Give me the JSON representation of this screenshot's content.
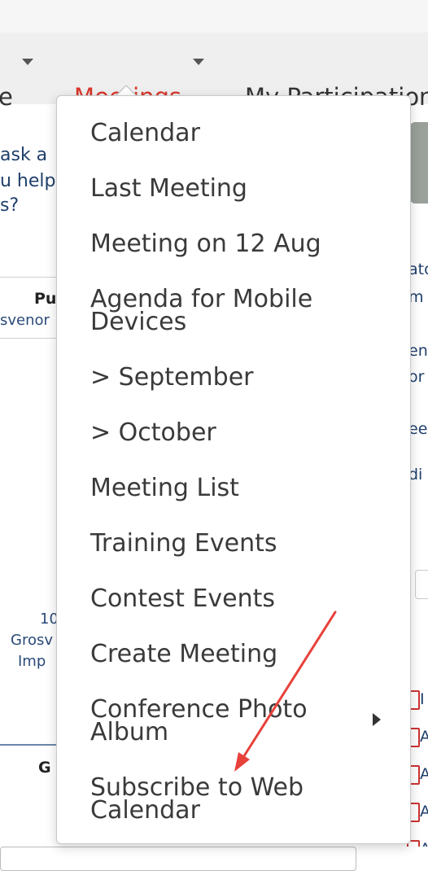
{
  "navbar": {
    "items": [
      {
        "label": "e"
      },
      {
        "label": "Meetings"
      },
      {
        "label": "My Participation"
      }
    ]
  },
  "background": {
    "left_text": [
      "ask a",
      "u help",
      "s?"
    ],
    "col_header": "Pu",
    "col_sub": "svenor",
    "address": [
      "10",
      "Grosv",
      "Imp"
    ],
    "lower_header": "G"
  },
  "right_strip": {
    "texts": [
      "ato",
      "m",
      "en",
      "or",
      "ee",
      "di"
    ],
    "badge_letters": [
      "I",
      "A",
      "A",
      "A",
      "A"
    ]
  },
  "dropdown": {
    "items": [
      {
        "label": "Calendar"
      },
      {
        "label": "Last Meeting"
      },
      {
        "label": "Meeting on 12 Aug"
      },
      {
        "label": "Agenda for Mobile Devices"
      },
      {
        "label": "> September"
      },
      {
        "label": "> October"
      },
      {
        "label": "Meeting List"
      },
      {
        "label": "Training Events"
      },
      {
        "label": "Contest Events"
      },
      {
        "label": "Create Meeting"
      },
      {
        "label": "Conference Photo Album",
        "has_submenu": true
      },
      {
        "label": "Subscribe to Web Calendar"
      }
    ]
  },
  "colors": {
    "accent_red": "#d8352a",
    "menu_text": "#3a3a3a",
    "annotation_arrow": "#e8413a"
  }
}
